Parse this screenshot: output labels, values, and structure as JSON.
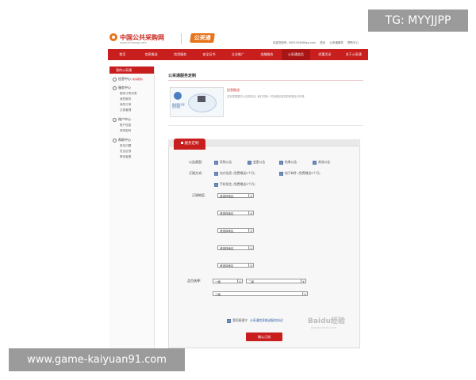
{
  "header": {
    "site_name": "中国公共采购网",
    "site_url": "www.chinacpp.com",
    "brand": "公采通",
    "top_links": [
      "欢迎您回来, 50053448@qq.com",
      "退出",
      "公采通服务",
      "帮助中心"
    ]
  },
  "nav": {
    "items": [
      "首页",
      "信息推送",
      "信用服务",
      "安全证书",
      "企业推广",
      "金融服务",
      "公采通会员",
      "优惠活动",
      "关于公采通"
    ],
    "active_index": 6
  },
  "sidebar": {
    "title": "我的公采通",
    "groups": [
      {
        "label": "信息中心",
        "badge": "(未来服务)",
        "icon": "info-icon",
        "links": []
      },
      {
        "label": "服务中心",
        "icon": "service-icon",
        "links": [
          "服务订购列表",
          "我的服务",
          "我的订单",
          "交易管理"
        ]
      },
      {
        "label": "账户中心",
        "icon": "account-icon",
        "links": [
          "账户信息",
          "修改密码"
        ]
      },
      {
        "label": "帮助中心",
        "icon": "help-icon",
        "links": [
          "常见问题",
          "意见反馈",
          "联系客服"
        ]
      }
    ]
  },
  "main": {
    "title": "公采通服务定制",
    "info_title": "信息推送",
    "info_body": "定制您需要的公告类信息, 我们将第一时间推送到您的邮箱及手机等",
    "illus_caption": "推送服务实现每天更新",
    "section_label": "服务定制",
    "form": {
      "type_label": "公告类型:",
      "type_options": [
        {
          "label": "采购公告",
          "checked": true
        },
        {
          "label": "变更公告",
          "checked": true
        },
        {
          "label": "结果公告",
          "checked": true
        },
        {
          "label": "其他公告",
          "checked": true
        }
      ],
      "method_label": "订阅方式:",
      "method_options": [
        {
          "label": "站内信息 (免费赠送5个月)",
          "checked": true
        },
        {
          "label": "电子邮件 (免费赠送5个月)",
          "checked": true
        },
        {
          "label": "手机短信 (免费赠送5个月)",
          "checked": true
        }
      ],
      "region_label": "订阅地区:",
      "region_placeholder": "请选择地区",
      "region_count": 5,
      "category_label": "品目选择:",
      "category_select1": "一级",
      "category_select2": "二级",
      "category_select3": "三级",
      "agree_text": "我同意遵守",
      "agree_link": "公采通信息推送服务协议",
      "submit_label": "确认订阅"
    }
  },
  "watermarks": {
    "tag": "TG: MYYJJPP",
    "url": "www.game-kaiyuan91.com",
    "baidu": "Baidu经验",
    "baidu_sub": "jingyan.baidu.com"
  },
  "colors": {
    "brand_red": "#c81e1e",
    "brand_orange": "#e8741c"
  }
}
